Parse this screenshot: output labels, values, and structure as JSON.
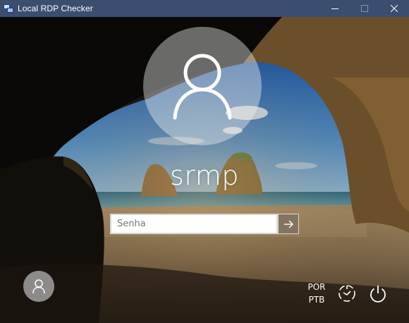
{
  "window": {
    "title": "Local RDP Checker",
    "app_icon": "rdp-monitors-icon",
    "controls": [
      "minimize",
      "maximize",
      "close"
    ]
  },
  "lock_screen": {
    "avatar_icon": "user-icon",
    "username": "srmp",
    "password": {
      "placeholder": "Senha",
      "value": ""
    },
    "submit_icon": "arrow-right-icon",
    "switch_user_icon": "user-icon",
    "language": {
      "line1": "POR",
      "line2": "PTB"
    },
    "ease_of_access_icon": "ease-of-access-icon",
    "power_icon": "power-icon"
  },
  "colors": {
    "titlebar": "#3b4e70",
    "submit_button": "#827462",
    "input_border": "#d7d7d7"
  }
}
